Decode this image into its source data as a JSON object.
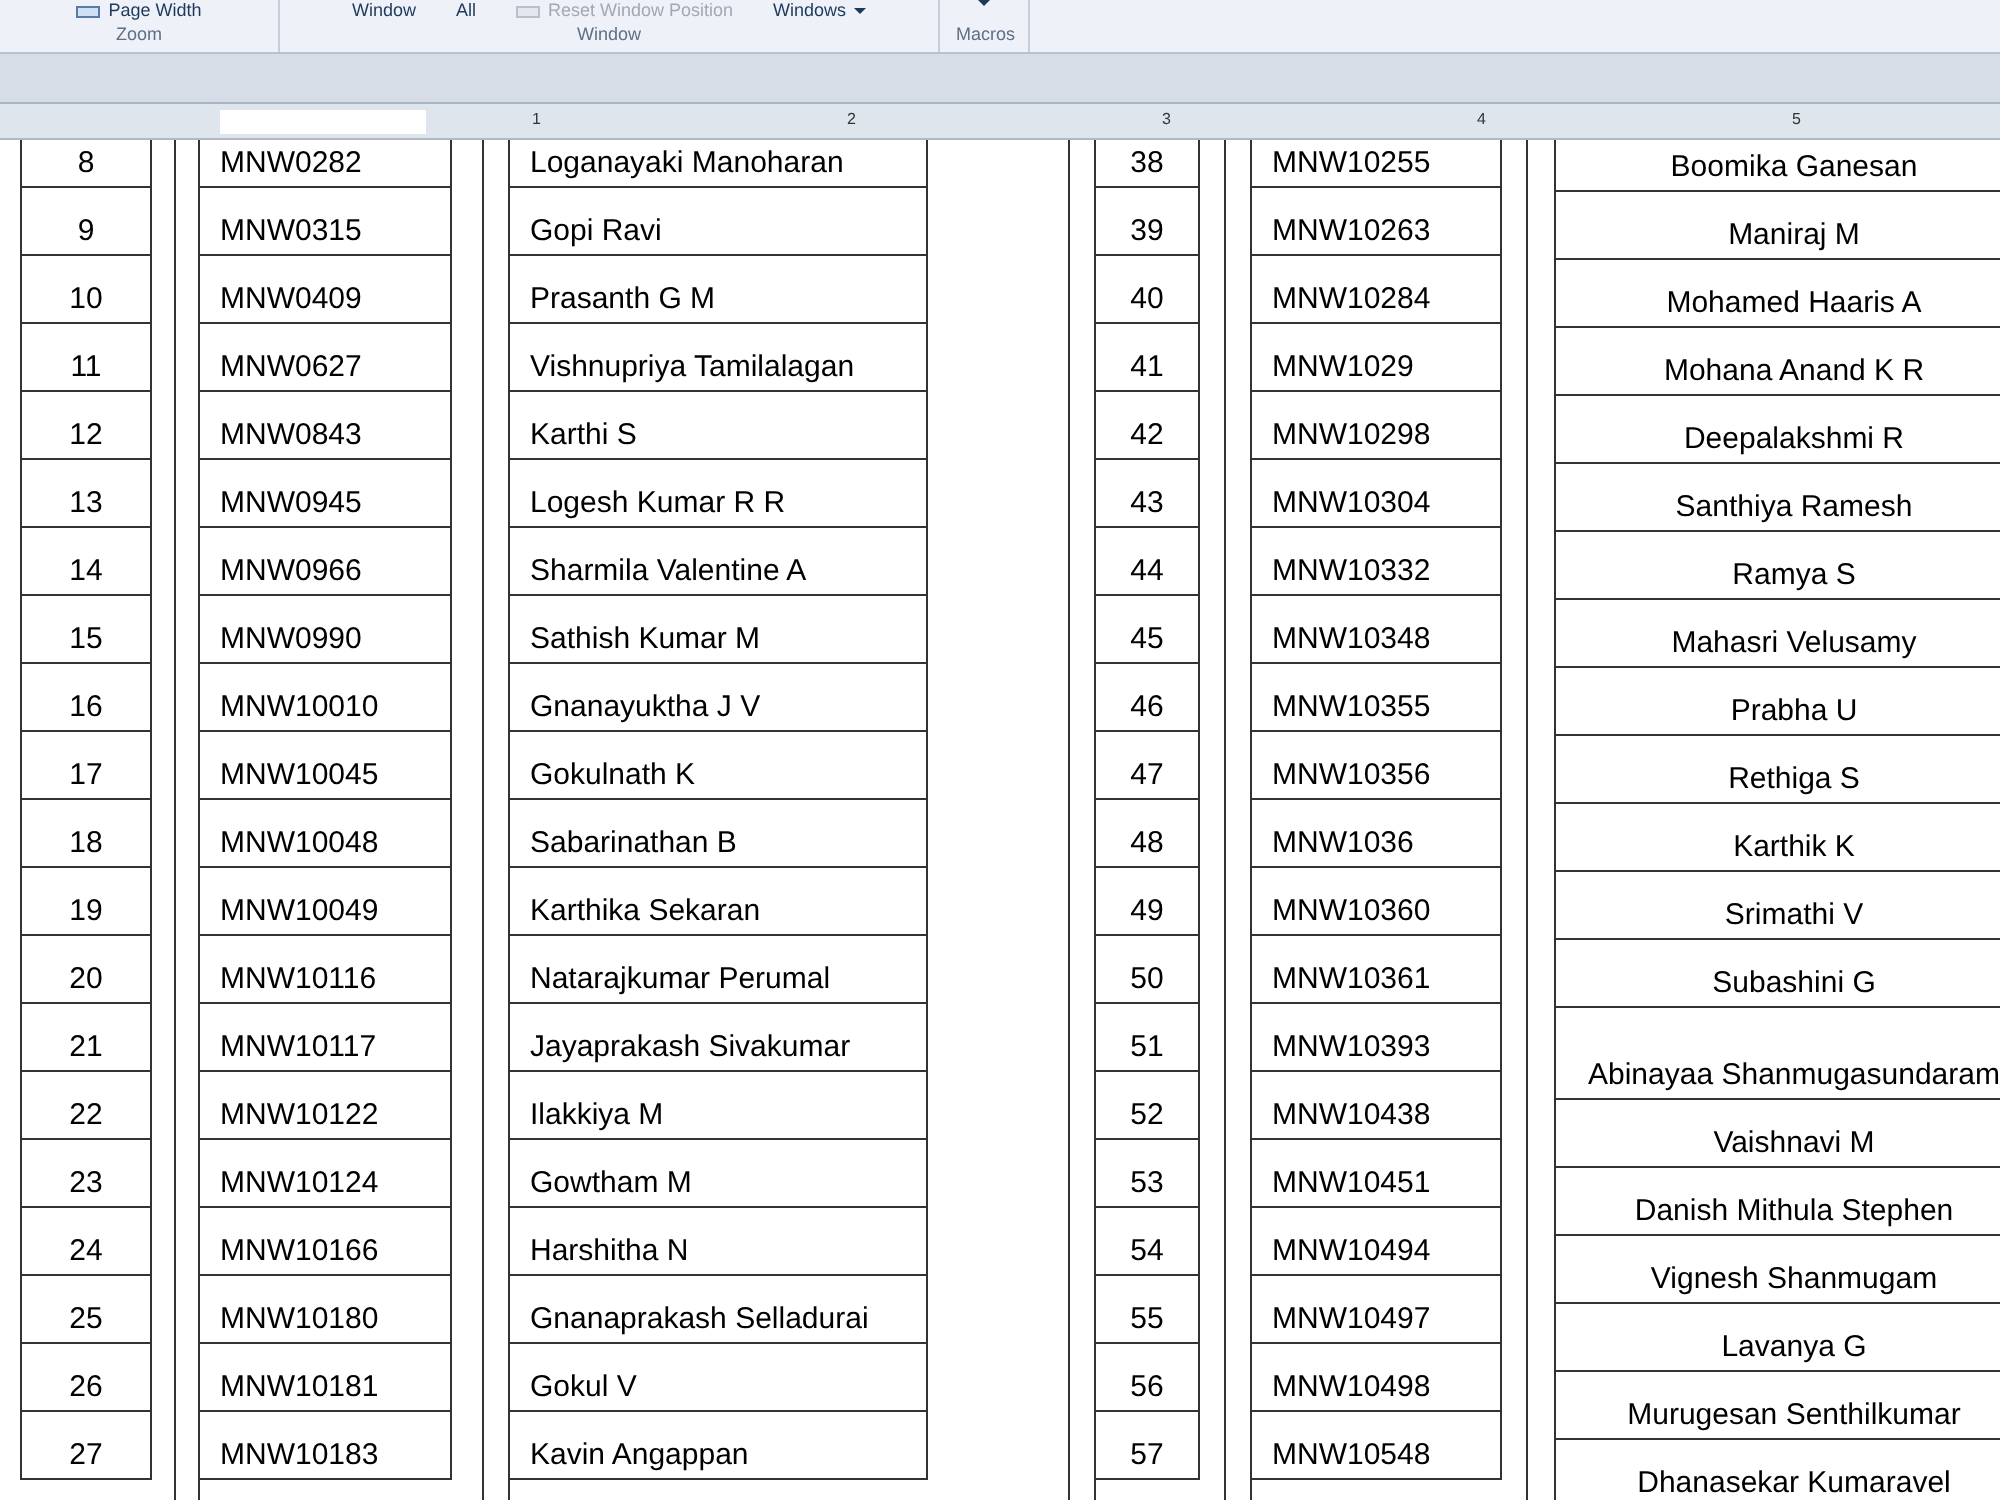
{
  "ribbon": {
    "groups": [
      {
        "label": "Zoom",
        "items": [
          {
            "label": "Page Width",
            "kind": "icon",
            "disabled": false
          }
        ]
      },
      {
        "label": "Window",
        "items": [
          {
            "label": "Window",
            "kind": "plain",
            "disabled": false
          },
          {
            "label": "All",
            "kind": "plain",
            "disabled": false
          },
          {
            "label": "Reset Window Position",
            "kind": "icon",
            "disabled": true
          },
          {
            "label": "Windows",
            "kind": "dropdown",
            "disabled": false
          }
        ]
      },
      {
        "label": "Macros",
        "items": [
          {
            "kind": "dropdown",
            "disabled": false
          }
        ]
      }
    ]
  },
  "ruler": {
    "labels": [
      "1",
      "2",
      "3",
      "4",
      "5"
    ]
  },
  "table_left": {
    "rows": [
      {
        "number": "8",
        "id": "MNW0282",
        "name": "Loganayaki Manoharan"
      },
      {
        "number": "9",
        "id": "MNW0315",
        "name": "Gopi Ravi"
      },
      {
        "number": "10",
        "id": "MNW0409",
        "name": "Prasanth G M"
      },
      {
        "number": "11",
        "id": "MNW0627",
        "name": "Vishnupriya Tamilalagan"
      },
      {
        "number": "12",
        "id": "MNW0843",
        "name": "Karthi S"
      },
      {
        "number": "13",
        "id": "MNW0945",
        "name": "Logesh Kumar R R"
      },
      {
        "number": "14",
        "id": "MNW0966",
        "name": "Sharmila Valentine A"
      },
      {
        "number": "15",
        "id": "MNW0990",
        "name": "Sathish Kumar M"
      },
      {
        "number": "16",
        "id": "MNW10010",
        "name": "Gnanayuktha J V"
      },
      {
        "number": "17",
        "id": "MNW10045",
        "name": "Gokulnath K"
      },
      {
        "number": "18",
        "id": "MNW10048",
        "name": "Sabarinathan B"
      },
      {
        "number": "19",
        "id": "MNW10049",
        "name": "Karthika Sekaran"
      },
      {
        "number": "20",
        "id": "MNW10116",
        "name": "Natarajkumar Perumal"
      },
      {
        "number": "21",
        "id": "MNW10117",
        "name": "Jayaprakash Sivakumar"
      },
      {
        "number": "22",
        "id": "MNW10122",
        "name": "Ilakkiya M"
      },
      {
        "number": "23",
        "id": "MNW10124",
        "name": "Gowtham M"
      },
      {
        "number": "24",
        "id": "MNW10166",
        "name": "Harshitha N"
      },
      {
        "number": "25",
        "id": "MNW10180",
        "name": "Gnanaprakash Selladurai"
      },
      {
        "number": "26",
        "id": "MNW10181",
        "name": "Gokul V"
      },
      {
        "number": "27",
        "id": "MNW10183",
        "name": "Kavin Angappan"
      }
    ]
  },
  "table_right": {
    "rows": [
      {
        "number": "38",
        "id": "MNW10255",
        "name": "Boomika Ganesan"
      },
      {
        "number": "39",
        "id": "MNW10263",
        "name": "Maniraj M"
      },
      {
        "number": "40",
        "id": "MNW10284",
        "name": "Mohamed Haaris A"
      },
      {
        "number": "41",
        "id": "MNW1029",
        "name": "Mohana Anand K R"
      },
      {
        "number": "42",
        "id": "MNW10298",
        "name": "Deepalakshmi R"
      },
      {
        "number": "43",
        "id": "MNW10304",
        "name": "Santhiya Ramesh"
      },
      {
        "number": "44",
        "id": "MNW10332",
        "name": "Ramya S"
      },
      {
        "number": "45",
        "id": "MNW10348",
        "name": "Mahasri Velusamy"
      },
      {
        "number": "46",
        "id": "MNW10355",
        "name": "Prabha U"
      },
      {
        "number": "47",
        "id": "MNW10356",
        "name": "Rethiga S"
      },
      {
        "number": "48",
        "id": "MNW1036",
        "name": "Karthik K"
      },
      {
        "number": "49",
        "id": "MNW10360",
        "name": "Srimathi V"
      },
      {
        "number": "50",
        "id": "MNW10361",
        "name": "Subashini G"
      },
      {
        "number": "51",
        "id": "MNW10393",
        "name": "Abinayaa Shanmugasundaram"
      },
      {
        "number": "52",
        "id": "MNW10438",
        "name": "Vaishnavi M"
      },
      {
        "number": "53",
        "id": "MNW10451",
        "name": "Danish Mithula Stephen"
      },
      {
        "number": "54",
        "id": "MNW10494",
        "name": "Vignesh Shanmugam"
      },
      {
        "number": "55",
        "id": "MNW10497",
        "name": "Lavanya G"
      },
      {
        "number": "56",
        "id": "MNW10498",
        "name": "Murugesan Senthilkumar"
      },
      {
        "number": "57",
        "id": "MNW10548",
        "name": "Dhanasekar Kumaravel"
      }
    ]
  }
}
